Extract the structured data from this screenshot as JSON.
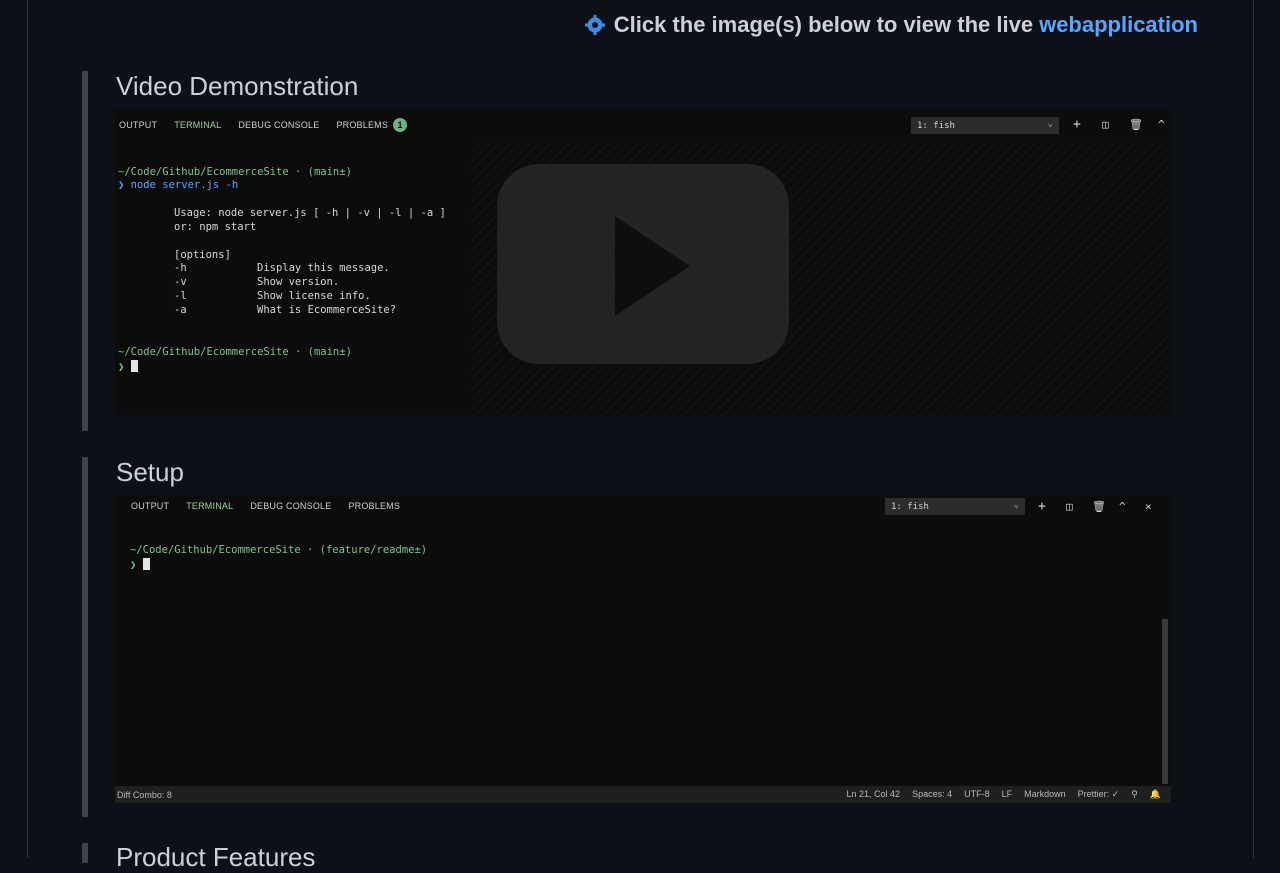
{
  "header": {
    "prefix": "Click the image(s) below to view the live",
    "link": "webapplication"
  },
  "video_section": {
    "title": "Video Demonstration",
    "tabs": [
      "OUTPUT",
      "TERMINAL",
      "DEBUG CONSOLE",
      "PROBLEMS"
    ],
    "problems_count": "1",
    "shell": "1: fish",
    "lines": {
      "path1": "~/Code/Github/EcommerceSite · (main±)",
      "prompt": "❯",
      "cmd": "node",
      "args": "server.js -h",
      "usage1": "Usage: node server.js [ -h | -v | -l | -a ]",
      "usage2": "or: npm start",
      "options": "[options]",
      "opt_h": "-h",
      "opt_h_desc": "Display this message.",
      "opt_v": "-v",
      "opt_v_desc": "Show version.",
      "opt_l": "-l",
      "opt_l_desc": "Show license info.",
      "opt_a": "-a",
      "opt_a_desc": "What is EcommerceSite?",
      "path2": "~/Code/Github/EcommerceSite · (main±)",
      "prompt2": "❯"
    }
  },
  "setup_section": {
    "title": "Setup",
    "tabs": [
      "OUTPUT",
      "TERMINAL",
      "DEBUG CONSOLE",
      "PROBLEMS"
    ],
    "shell": "1: fish",
    "path": "~/Code/Github/EcommerceSite · (feature/readme±)",
    "prompt": "❯",
    "status_left": "Diff Combo: 8",
    "status_right": [
      "Ln 21, Col 42",
      "Spaces: 4",
      "UTF-8",
      "LF",
      "Markdown",
      "Prettier: ✓",
      "⚲",
      "🔔"
    ]
  },
  "next_section": {
    "title": "Product Features"
  },
  "colors": {
    "link": "#58a6ff",
    "accent_green": "#7fc58e",
    "bg": "#0d1117"
  }
}
